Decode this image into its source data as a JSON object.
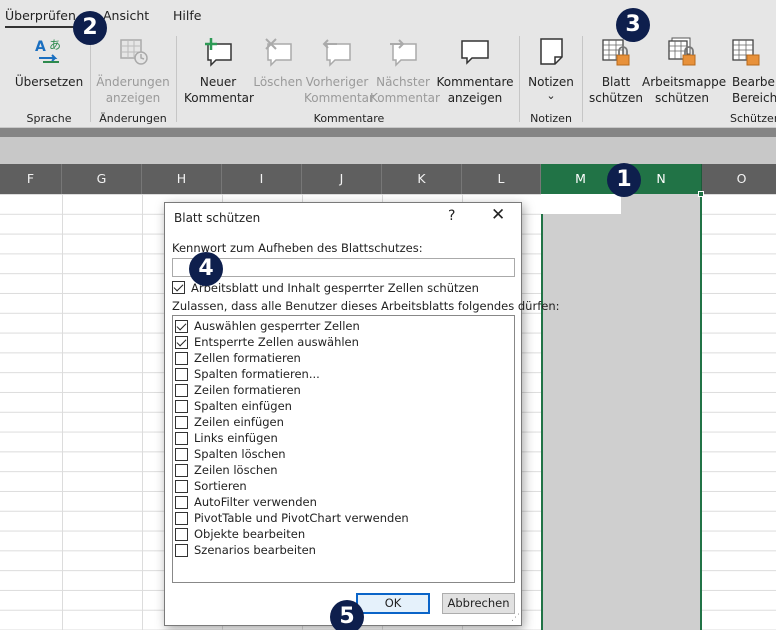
{
  "ribbon_tabs": [
    "Überprüfen",
    "Ansicht",
    "Hilfe"
  ],
  "ribbon": {
    "translate": "Übersetzen",
    "track_changes_l1": "Änderungen",
    "track_changes_l2": "anzeigen",
    "new_comment_l1": "Neuer",
    "new_comment_l2": "Kommentar",
    "delete": "Löschen",
    "prev_l1": "Vorheriger",
    "prev_l2": "Kommentar",
    "next_l1": "Nächster",
    "next_l2": "Kommentar",
    "show_comments_l1": "Kommentare",
    "show_comments_l2": "anzeigen",
    "notes": "Notizen",
    "notes_caret": "⌄",
    "protect_sheet_l1": "Blatt",
    "protect_sheet_l2": "schützen",
    "protect_wb_l1": "Arbeitsmappe",
    "protect_wb_l2": "schützen",
    "allow_edit_l1": "Bearbeit",
    "allow_edit_l2": "Bereichen",
    "group_language": "Sprache",
    "group_changes": "Änderungen",
    "group_comments": "Kommentare",
    "group_notes": "Notizen",
    "group_protect": "Schützen"
  },
  "columns": [
    "F",
    "G",
    "H",
    "I",
    "J",
    "K",
    "L",
    "M",
    "N",
    "O"
  ],
  "dialog": {
    "title": "Blatt schützen",
    "help": "?",
    "close": "✕",
    "password_label": "Kennwort zum Aufheben des Blattschutzes:",
    "password_value": "",
    "protect_label": "Arbeitsblatt und Inhalt gesperrter Zellen schützen",
    "protect_checked": true,
    "allow_label": "Zulassen, dass alle Benutzer dieses Arbeitsblatts folgendes dürfen:",
    "options": [
      {
        "label": "Auswählen gesperrter Zellen",
        "checked": true
      },
      {
        "label": "Entsperrte Zellen auswählen",
        "checked": true
      },
      {
        "label": "Zellen formatieren",
        "checked": false
      },
      {
        "label": "Spalten formatieren...",
        "checked": false
      },
      {
        "label": "Zeilen formatieren",
        "checked": false
      },
      {
        "label": "Spalten einfügen",
        "checked": false
      },
      {
        "label": "Zeilen einfügen",
        "checked": false
      },
      {
        "label": "Links einfügen",
        "checked": false
      },
      {
        "label": "Spalten löschen",
        "checked": false
      },
      {
        "label": "Zeilen löschen",
        "checked": false
      },
      {
        "label": "Sortieren",
        "checked": false
      },
      {
        "label": "AutoFilter verwenden",
        "checked": false
      },
      {
        "label": "PivotTable und PivotChart verwenden",
        "checked": false
      },
      {
        "label": "Objekte bearbeiten",
        "checked": false
      },
      {
        "label": "Szenarios bearbeiten",
        "checked": false
      }
    ],
    "ok": "OK",
    "cancel": "Abbrechen"
  },
  "badges": [
    "1",
    "2",
    "3",
    "4",
    "5"
  ],
  "colors": {
    "accent_green": "#217346",
    "badge": "#0e1f4d",
    "ok_border": "#0a64c8",
    "lock": "#e8913a"
  }
}
